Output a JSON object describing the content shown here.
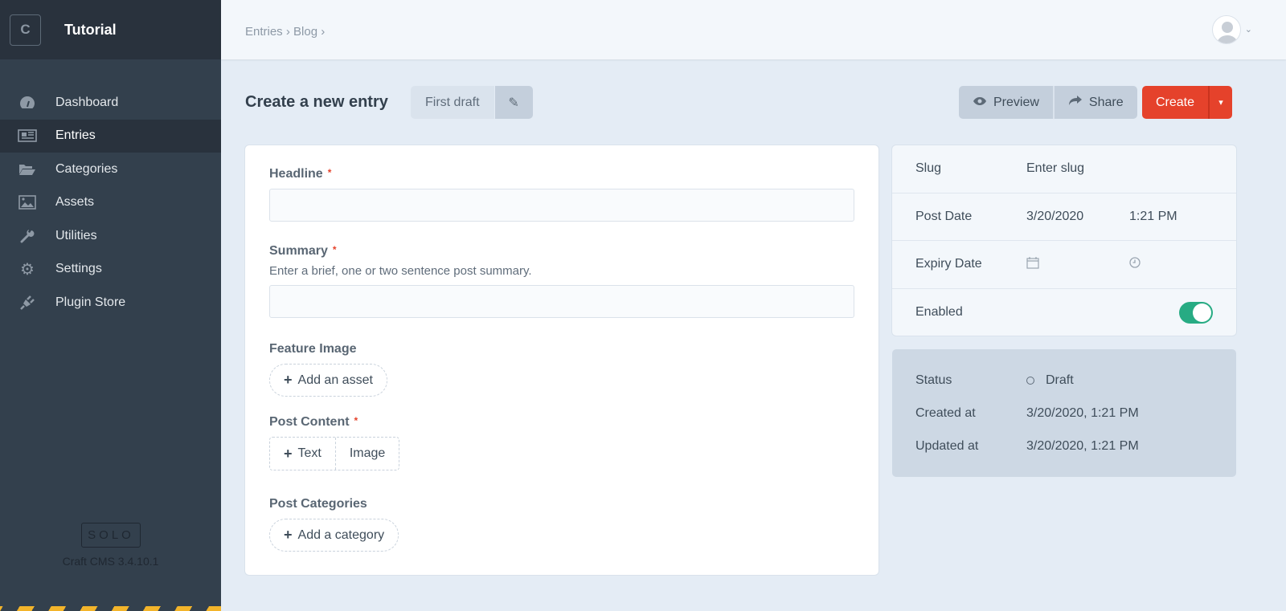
{
  "site": {
    "logo_letter": "C",
    "name": "Tutorial"
  },
  "nav": [
    {
      "label": "Dashboard",
      "icon": "gauge-icon"
    },
    {
      "label": "Entries",
      "icon": "newspaper-icon",
      "active": true
    },
    {
      "label": "Categories",
      "icon": "folder-open-icon"
    },
    {
      "label": "Assets",
      "icon": "image-icon"
    },
    {
      "label": "Utilities",
      "icon": "wrench-icon"
    },
    {
      "label": "Settings",
      "icon": "gear-icon"
    },
    {
      "label": "Plugin Store",
      "icon": "plug-icon"
    }
  ],
  "edition": "SOLO",
  "version": "Craft CMS 3.4.10.1",
  "breadcrumbs": [
    "Entries",
    "Blog"
  ],
  "page": {
    "title": "Create a new entry",
    "draft_name": "First draft"
  },
  "toolbar": {
    "preview": "Preview",
    "share": "Share",
    "create": "Create"
  },
  "fields": {
    "headline": {
      "label": "Headline",
      "required": "*"
    },
    "summary": {
      "label": "Summary",
      "required": "*",
      "instructions": "Enter a brief, one or two sentence post summary."
    },
    "feature_image": {
      "label": "Feature Image",
      "button": "Add an asset"
    },
    "post_content": {
      "label": "Post Content",
      "required": "*",
      "blocks": [
        "Text",
        "Image"
      ]
    },
    "post_categories": {
      "label": "Post Categories",
      "button": "Add a category"
    }
  },
  "meta": {
    "slug": {
      "label": "Slug",
      "placeholder": "Enter slug"
    },
    "post_date": {
      "label": "Post Date",
      "date": "3/20/2020",
      "time": "1:21 PM"
    },
    "expiry_date": {
      "label": "Expiry Date"
    },
    "enabled": {
      "label": "Enabled",
      "value": true
    }
  },
  "info": {
    "status": {
      "label": "Status",
      "value": "Draft"
    },
    "created": {
      "label": "Created at",
      "value": "3/20/2020, 1:21 PM"
    },
    "updated": {
      "label": "Updated at",
      "value": "3/20/2020, 1:21 PM"
    }
  },
  "colors": {
    "accent": "#e5422b",
    "toggle": "#27ab83",
    "sidebar": "#33404d"
  }
}
